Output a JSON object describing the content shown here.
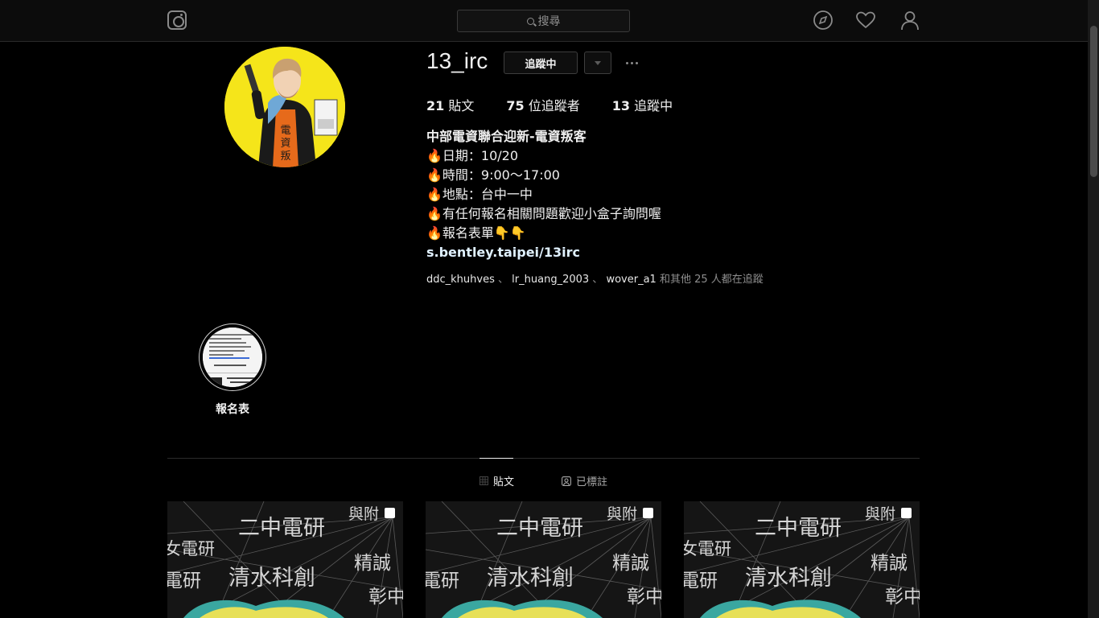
{
  "nav": {
    "search_placeholder": "搜尋",
    "icons": [
      "instagram-logo-icon",
      "search-icon",
      "compass-icon",
      "heart-icon",
      "user-icon"
    ]
  },
  "profile": {
    "username": "13_irc",
    "follow_button": "追蹤中",
    "stats": [
      {
        "count": "21",
        "label": " 貼文"
      },
      {
        "count": "75",
        "label": " 位追蹤者"
      },
      {
        "count": "13",
        "label": " 追蹤中"
      }
    ],
    "bio": {
      "title": "中部電資聯合迎新-電資叛客",
      "emoji": "🔥",
      "lines": [
        "日期：10/20",
        "時間：9:00～17:00",
        "地點：台中一中",
        "有任何報名相關問題歡迎小盒子詢問喔",
        "報名表單👇👇"
      ],
      "link": "s.bentley.taipei/13irc"
    },
    "followed_by": {
      "users": [
        "ddc_khuhves",
        "lr_huang_2003",
        "wover_a1"
      ],
      "separator": "、",
      "suffix": " 和其他 25 人都在追蹤"
    }
  },
  "highlight": {
    "label": "報名表"
  },
  "tabs": [
    {
      "label": "貼文",
      "active": true
    },
    {
      "label": "已標註",
      "active": false
    }
  ],
  "post_text": {
    "a": "二中電研",
    "b": "與附",
    "c": "女電研",
    "d": "電研",
    "e": "清水科創",
    "f": "精誠",
    "g": "彰中"
  },
  "colors": {
    "background": "#000000",
    "nav": "#0c0c0c",
    "avatar_bg": "#f5e51a",
    "fire": "#ff6a00"
  }
}
